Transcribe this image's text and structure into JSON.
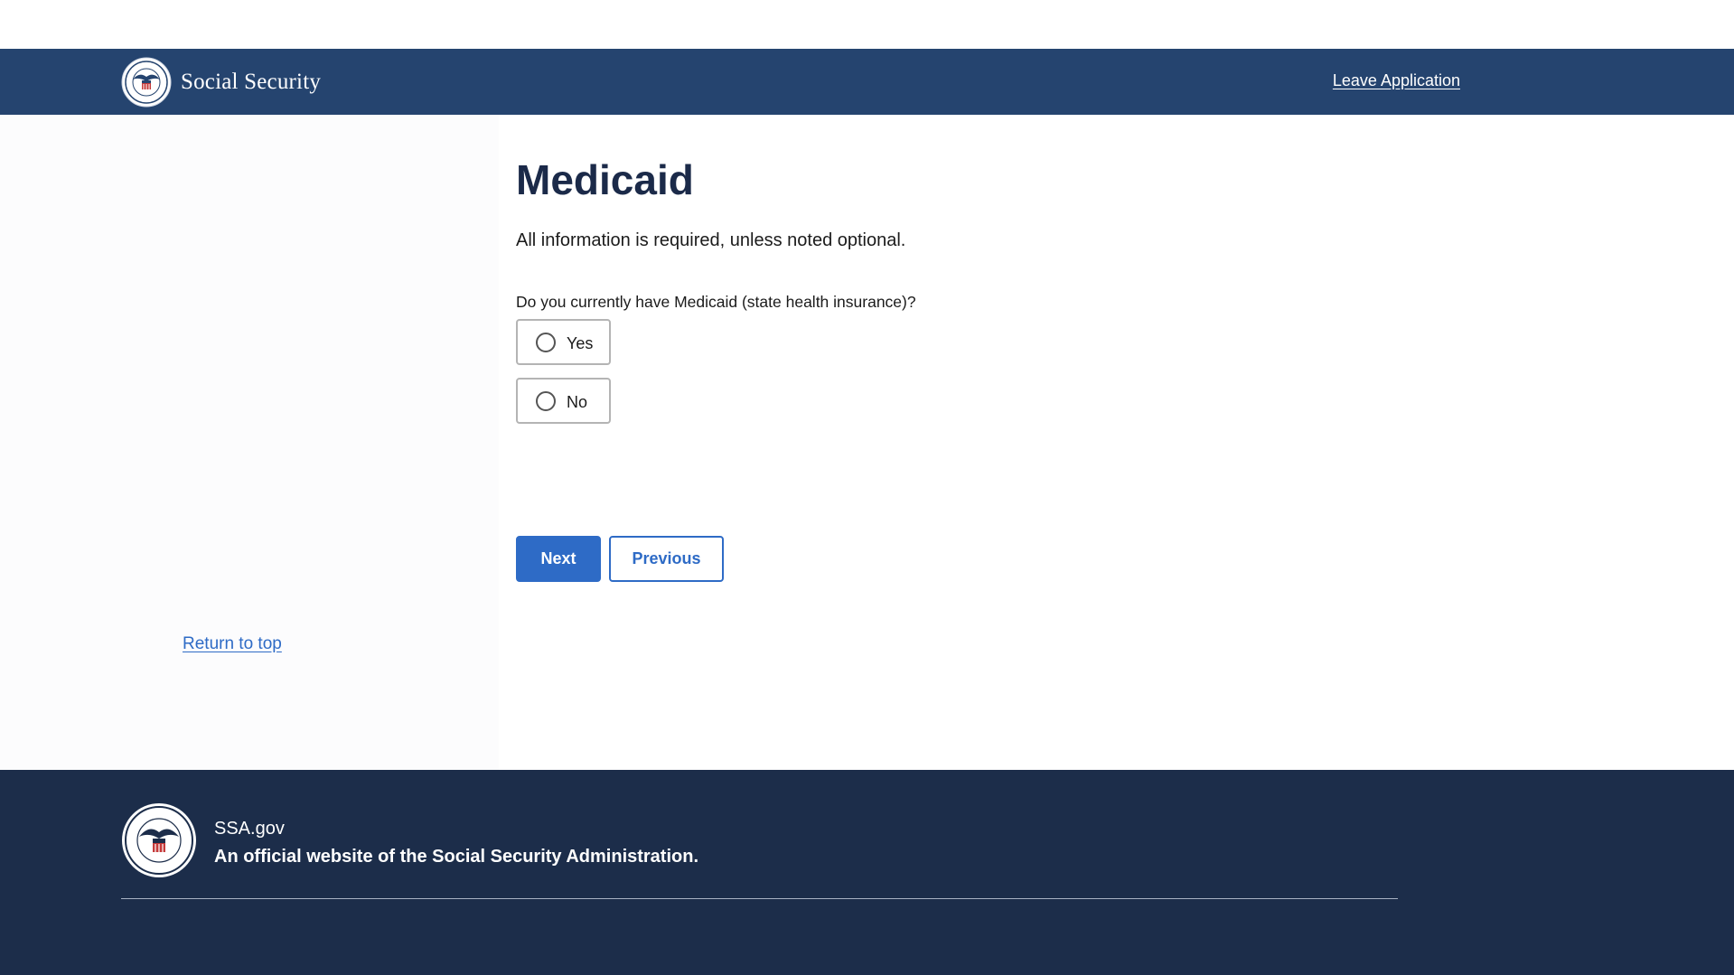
{
  "header": {
    "brand_name": "Social Security",
    "leave_link": "Leave Application",
    "logo_icon": "ssa-seal-icon"
  },
  "page": {
    "title": "Medicaid",
    "intro": "All information is required, unless noted optional.",
    "question": "Do you currently have Medicaid (state health insurance)?",
    "options": [
      {
        "label": "Yes",
        "selected": false
      },
      {
        "label": "No",
        "selected": false
      }
    ],
    "next_label": "Next",
    "previous_label": "Previous",
    "return_to_top": "Return to top"
  },
  "footer": {
    "site": "SSA.gov",
    "tagline": "An official website of the Social Security Administration.",
    "logo_icon": "ssa-seal-icon"
  },
  "colors": {
    "header_bg": "#25446f",
    "footer_bg": "#1c2d4a",
    "primary": "#2e6bc6",
    "title": "#1b2a49"
  }
}
